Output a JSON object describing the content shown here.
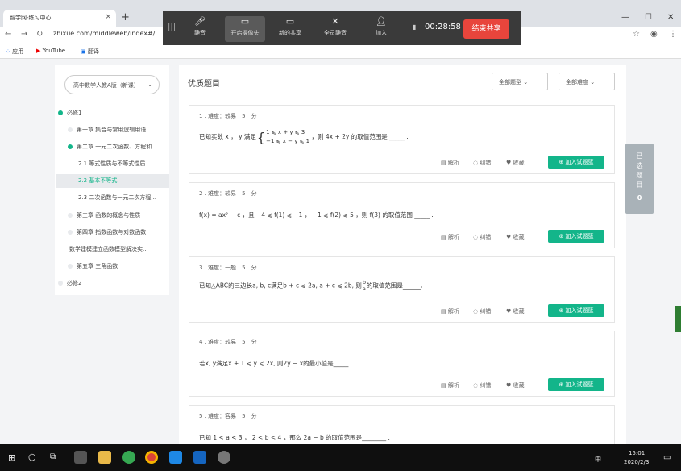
{
  "browser": {
    "tab_title": "智学网-练习中心",
    "tab_close": "×",
    "newtab": "+",
    "url": "zhixue.com/middleweb/index#/",
    "min": "—",
    "max": "☐",
    "close": "✕",
    "bookmarks": [
      "应用",
      "YouTube",
      "翻译"
    ]
  },
  "share_bar": {
    "items": [
      "静音",
      "开启摄像头",
      "新的共享",
      "全员静音",
      "加入"
    ],
    "timer": "00:28:58",
    "stop": "结束共享"
  },
  "sidebar": {
    "select": "高中数学人教A版（新课）",
    "tree": [
      "必修1",
      "第一章 集合与常用逻辑用语",
      "第二章 一元二次函数、方程和...",
      "2.1 等式性质与不等式性质",
      "2.2 基本不等式",
      "2.3 二次函数与一元二次方程...",
      "第三章 函数的概念与性质",
      "第四章 指数函数与对数函数",
      "数学建模建立函数模型解决实...",
      "第五章 三角函数",
      "必修2"
    ]
  },
  "main": {
    "title": "优质题目",
    "filter_type": "全部题型",
    "filter_diff": "全部难度",
    "actions": [
      "解析",
      "纠错",
      "收藏"
    ],
    "add_label": "加入试题篮",
    "questions": [
      {
        "head": "1 . 难度：较易　5　分",
        "text_a": "已知实数 x ，  y 满足",
        "sys1": "1 ⩽ x + y ⩽ 3",
        "sys2": "−1 ⩽ x − y ⩽ 1",
        "text_b": "，则 4x + 2y 的取值范围是 _____ ."
      },
      {
        "head": "2 . 难度：较易　5　分",
        "text": "f(x) = ax² − c ，且 −4 ⩽ f(1) ⩽ −1 ， −1 ⩽ f(2) ⩽ 5 ，则 f(3) 的取值范围 _____ ."
      },
      {
        "head": "3 . 难度：一般　5　分",
        "text_a": "已知△ABC的三边长a, b, c满足b + c ⩽ 2a, a + c ⩽ 2b, 则",
        "num": "b",
        "den": "a",
        "text_b": "的取值范围是______."
      },
      {
        "head": "4 . 难度：较易　5　分",
        "text": "若x, y满足x + 1 ⩽ y ⩽ 2x, 则2y − x的最小值是_____."
      },
      {
        "head": "5 . 难度：容易　5　分",
        "text": "已知 1 < a < 3 ， 2 < b < 4 ，那么 2a − b 的取值范围是________ ."
      }
    ]
  },
  "right_panel": {
    "label": "已选题目",
    "count": "0"
  },
  "taskbar": {
    "ime": "中",
    "time": "15:01",
    "date": "2020/2/3"
  }
}
